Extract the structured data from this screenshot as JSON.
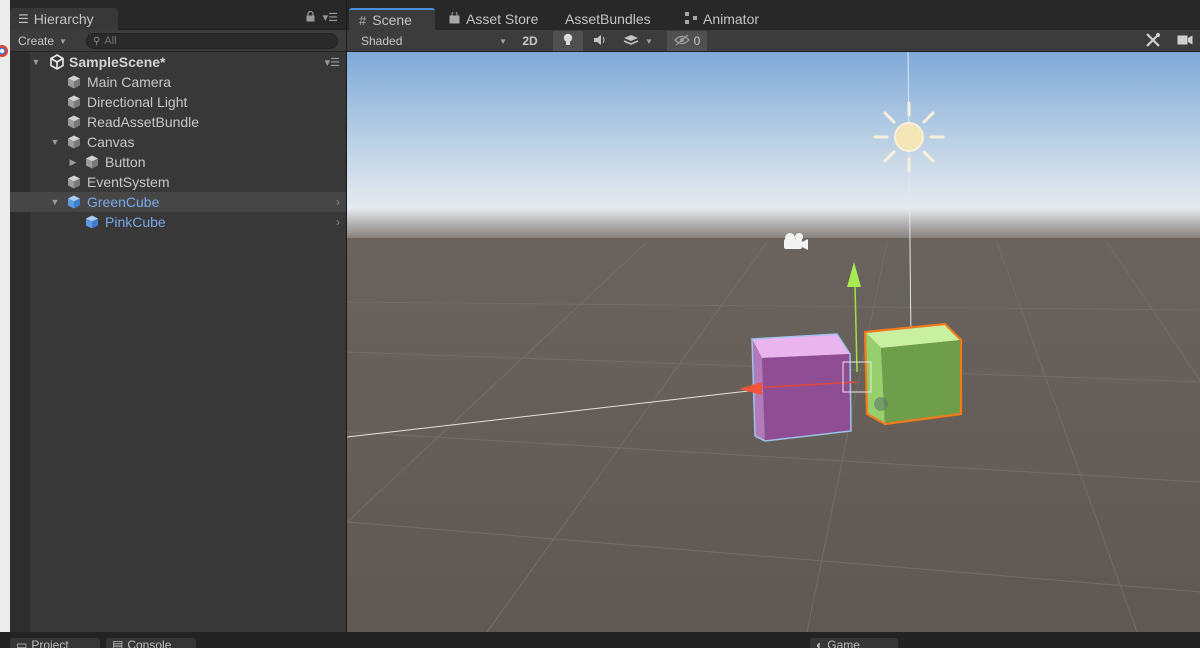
{
  "hierarchy": {
    "tab_label": "Hierarchy",
    "tab_icon": "hierarchy-list-icon",
    "create_label": "Create",
    "search_placeholder": "All",
    "scene_name": "SampleScene*",
    "items": [
      {
        "label": "Main Camera"
      },
      {
        "label": "Directional Light"
      },
      {
        "label": "ReadAssetBundle"
      },
      {
        "label": "Canvas"
      },
      {
        "label": "Button"
      },
      {
        "label": "EventSystem"
      },
      {
        "label": "GreenCube"
      },
      {
        "label": "PinkCube"
      }
    ]
  },
  "scene": {
    "tabs": [
      {
        "label": "Scene",
        "icon": "grid-icon",
        "active": true
      },
      {
        "label": "Asset Store",
        "icon": "store-bag-icon"
      },
      {
        "label": "AssetBundles",
        "icon": ""
      },
      {
        "label": "Animator",
        "icon": "animator-icon"
      }
    ],
    "draw_mode": "Shaded",
    "mode_2d_label": "2D",
    "hidden_count": "0"
  },
  "bottom": {
    "tabs": [
      {
        "label": "Project"
      },
      {
        "label": "Console"
      },
      {
        "label": "Game"
      }
    ]
  },
  "colors": {
    "panel": "#383838",
    "selected_text": "#7aa8e8",
    "accent": "#4a8fe0",
    "pink_cube": "#e8a8ee",
    "green_cube": "#a9e37e",
    "selection_outline": "#f07a1c"
  }
}
